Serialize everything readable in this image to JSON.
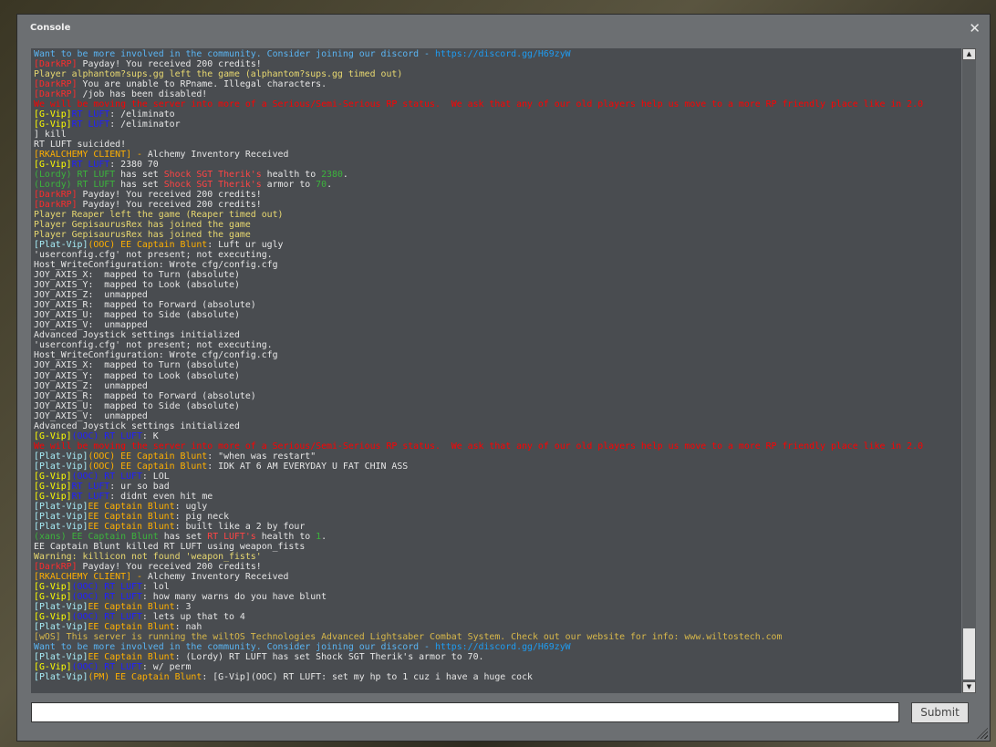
{
  "window": {
    "title": "Console",
    "close_icon": "close-icon"
  },
  "input": {
    "value": "",
    "placeholder": ""
  },
  "submit_label": "Submit",
  "colors": {
    "w": "#e6e6e6",
    "c": "#5ab4f2",
    "l": "#1e9cf2",
    "r": "#ff2c2c",
    "y": "#e8d870",
    "R": "#ff0000",
    "g": "#ffff00",
    "b": "#2020ff",
    "p": "#a8eef8",
    "o": "#ffb000",
    "G": "#3cb43c",
    "s": "#ff4444",
    "d": "#d8b84a"
  },
  "lines": [
    [
      [
        "Want to be more involved in the community. Consider joining our discord - ",
        "c"
      ],
      [
        "https://discord.gg/H69zyW",
        "l"
      ]
    ],
    [
      [
        "[DarkRP] ",
        "r"
      ],
      [
        "Payday! You received 200 credits!",
        "w"
      ]
    ],
    [
      [
        "Player alphantom?sups.gg left the game (alphantom?sups.gg timed out)",
        "y"
      ]
    ],
    [
      [
        "[DarkRP] ",
        "r"
      ],
      [
        "You are unable to RPname. Illegal characters.",
        "w"
      ]
    ],
    [
      [
        "[DarkRP] ",
        "r"
      ],
      [
        "/job has been disabled!",
        "w"
      ]
    ],
    [
      [
        "We will be moving the server into more of a Serious/Semi-Serious RP status.  We ask that any of our old players help us move to a more RP friendly place like in 2.0",
        "R"
      ]
    ],
    [
      [
        "[G-Vip]",
        "g"
      ],
      [
        "RT LUFT",
        "b"
      ],
      [
        ": /eliminato",
        "w"
      ]
    ],
    [
      [
        "[G-Vip]",
        "g"
      ],
      [
        "RT LUFT",
        "b"
      ],
      [
        ": /eliminator",
        "w"
      ]
    ],
    [
      [
        "] kill",
        "w"
      ]
    ],
    [
      [
        "RT LUFT suicided!",
        "w"
      ]
    ],
    [
      [
        "[RKALCHEMY CLIENT] - ",
        "o"
      ],
      [
        "Alchemy Inventory Received",
        "w"
      ]
    ],
    [
      [
        "[G-Vip]",
        "g"
      ],
      [
        "RT LUFT",
        "b"
      ],
      [
        ": 2380 70",
        "w"
      ]
    ],
    [
      [
        "(Lordy) RT LUFT ",
        "G"
      ],
      [
        "has set ",
        "w"
      ],
      [
        "Shock SGT Therik's ",
        "s"
      ],
      [
        "health to ",
        "w"
      ],
      [
        "2380",
        "G"
      ],
      [
        ".",
        "w"
      ]
    ],
    [
      [
        "(Lordy) RT LUFT ",
        "G"
      ],
      [
        "has set ",
        "w"
      ],
      [
        "Shock SGT Therik's ",
        "s"
      ],
      [
        "armor to ",
        "w"
      ],
      [
        "70",
        "G"
      ],
      [
        ".",
        "w"
      ]
    ],
    [
      [
        "[DarkRP] ",
        "r"
      ],
      [
        "Payday! You received 200 credits!",
        "w"
      ]
    ],
    [
      [
        "[DarkRP] ",
        "r"
      ],
      [
        "Payday! You received 200 credits!",
        "w"
      ]
    ],
    [
      [
        "Player Reaper left the game (Reaper timed out)",
        "y"
      ]
    ],
    [
      [
        "Player GepisaurusRex has joined the game",
        "y"
      ]
    ],
    [
      [
        "Player GepisaurusRex has joined the game",
        "y"
      ]
    ],
    [
      [
        "[Plat-Vip]",
        "p"
      ],
      [
        "(OOC) EE Captain Blunt",
        "o"
      ],
      [
        ": Luft ur ugly",
        "w"
      ]
    ],
    [
      [
        "'userconfig.cfg' not present; not executing.",
        "w"
      ]
    ],
    [
      [
        "Host_WriteConfiguration: Wrote cfg/config.cfg",
        "w"
      ]
    ],
    [
      [
        "JOY_AXIS_X:  mapped to Turn (absolute)",
        "w"
      ]
    ],
    [
      [
        "JOY_AXIS_Y:  mapped to Look (absolute)",
        "w"
      ]
    ],
    [
      [
        "JOY_AXIS_Z:  unmapped",
        "w"
      ]
    ],
    [
      [
        "JOY_AXIS_R:  mapped to Forward (absolute)",
        "w"
      ]
    ],
    [
      [
        "JOY_AXIS_U:  mapped to Side (absolute)",
        "w"
      ]
    ],
    [
      [
        "JOY_AXIS_V:  unmapped",
        "w"
      ]
    ],
    [
      [
        "Advanced Joystick settings initialized",
        "w"
      ]
    ],
    [
      [
        "'userconfig.cfg' not present; not executing.",
        "w"
      ]
    ],
    [
      [
        "Host_WriteConfiguration: Wrote cfg/config.cfg",
        "w"
      ]
    ],
    [
      [
        "JOY_AXIS_X:  mapped to Turn (absolute)",
        "w"
      ]
    ],
    [
      [
        "JOY_AXIS_Y:  mapped to Look (absolute)",
        "w"
      ]
    ],
    [
      [
        "JOY_AXIS_Z:  unmapped",
        "w"
      ]
    ],
    [
      [
        "JOY_AXIS_R:  mapped to Forward (absolute)",
        "w"
      ]
    ],
    [
      [
        "JOY_AXIS_U:  mapped to Side (absolute)",
        "w"
      ]
    ],
    [
      [
        "JOY_AXIS_V:  unmapped",
        "w"
      ]
    ],
    [
      [
        "Advanced Joystick settings initialized",
        "w"
      ]
    ],
    [
      [
        "[G-Vip]",
        "g"
      ],
      [
        "(OOC) RT LUFT",
        "b"
      ],
      [
        ": K",
        "w"
      ]
    ],
    [
      [
        "We will be moving the server into more of a Serious/Semi-Serious RP status.  We ask that any of our old players help us move to a more RP friendly place like in 2.0",
        "R"
      ]
    ],
    [
      [
        "[Plat-Vip]",
        "p"
      ],
      [
        "(OOC) EE Captain Blunt",
        "o"
      ],
      [
        ": \"when was restart\"",
        "w"
      ]
    ],
    [
      [
        "[Plat-Vip]",
        "p"
      ],
      [
        "(OOC) EE Captain Blunt",
        "o"
      ],
      [
        ": IDK AT 6 AM EVERYDAY U FAT CHIN ASS",
        "w"
      ]
    ],
    [
      [
        "[G-Vip]",
        "g"
      ],
      [
        "(OOC) RT LUFT",
        "b"
      ],
      [
        ": LOL",
        "w"
      ]
    ],
    [
      [
        "[G-Vip]",
        "g"
      ],
      [
        "RT LUFT",
        "b"
      ],
      [
        ": ur so bad",
        "w"
      ]
    ],
    [
      [
        "[G-Vip]",
        "g"
      ],
      [
        "RT LUFT",
        "b"
      ],
      [
        ": didnt even hit me",
        "w"
      ]
    ],
    [
      [
        "[Plat-Vip]",
        "p"
      ],
      [
        "EE Captain Blunt",
        "o"
      ],
      [
        ": ugly",
        "w"
      ]
    ],
    [
      [
        "[Plat-Vip]",
        "p"
      ],
      [
        "EE Captain Blunt",
        "o"
      ],
      [
        ": pig neck",
        "w"
      ]
    ],
    [
      [
        "[Plat-Vip]",
        "p"
      ],
      [
        "EE Captain Blunt",
        "o"
      ],
      [
        ": built like a 2 by four",
        "w"
      ]
    ],
    [
      [
        "(xans) EE Captain Blunt ",
        "G"
      ],
      [
        "has set ",
        "w"
      ],
      [
        "RT LUFT's ",
        "s"
      ],
      [
        "health to ",
        "w"
      ],
      [
        "1",
        "G"
      ],
      [
        ".",
        "w"
      ]
    ],
    [
      [
        "EE Captain Blunt killed RT LUFT using weapon_fists",
        "w"
      ]
    ],
    [
      [
        "Warning: killicon not found 'weapon_fists'",
        "y"
      ]
    ],
    [
      [
        "[DarkRP] ",
        "r"
      ],
      [
        "Payday! You received 200 credits!",
        "w"
      ]
    ],
    [
      [
        "[RKALCHEMY CLIENT] - ",
        "o"
      ],
      [
        "Alchemy Inventory Received",
        "w"
      ]
    ],
    [
      [
        "[G-Vip]",
        "g"
      ],
      [
        "(OOC) RT LUFT",
        "b"
      ],
      [
        ": lol",
        "w"
      ]
    ],
    [
      [
        "[G-Vip]",
        "g"
      ],
      [
        "(OOC) RT LUFT",
        "b"
      ],
      [
        ": how many warns do you have blunt",
        "w"
      ]
    ],
    [
      [
        "[Plat-Vip]",
        "p"
      ],
      [
        "EE Captain Blunt",
        "o"
      ],
      [
        ": 3",
        "w"
      ]
    ],
    [
      [
        "[G-Vip]",
        "g"
      ],
      [
        "(OOC) RT LUFT",
        "b"
      ],
      [
        ": lets up that to 4",
        "w"
      ]
    ],
    [
      [
        "[Plat-Vip]",
        "p"
      ],
      [
        "EE Captain Blunt",
        "o"
      ],
      [
        ": nah",
        "w"
      ]
    ],
    [
      [
        "[wOS] This server is running the wiltOS Technologies Advanced Lightsaber Combat System. Check out our website for info: www.wiltostech.com",
        "d"
      ]
    ],
    [
      [
        "Want to be more involved in the community. Consider joining our discord - ",
        "c"
      ],
      [
        "https://discord.gg/H69zyW",
        "l"
      ]
    ],
    [
      [
        "[Plat-Vip]",
        "p"
      ],
      [
        "EE Captain Blunt",
        "o"
      ],
      [
        ": (Lordy) RT LUFT has set Shock SGT Therik's armor to 70.",
        "w"
      ]
    ],
    [
      [
        "[G-Vip]",
        "g"
      ],
      [
        "(OOC) RT LUFT",
        "b"
      ],
      [
        ": w/ perm",
        "w"
      ]
    ],
    [
      [
        "[Plat-Vip]",
        "p"
      ],
      [
        "(PM) EE Captain Blunt",
        "o"
      ],
      [
        ": [G-Vip](OOC) RT LUFT: set my hp to 1 cuz i have a huge cock",
        "w"
      ]
    ]
  ]
}
